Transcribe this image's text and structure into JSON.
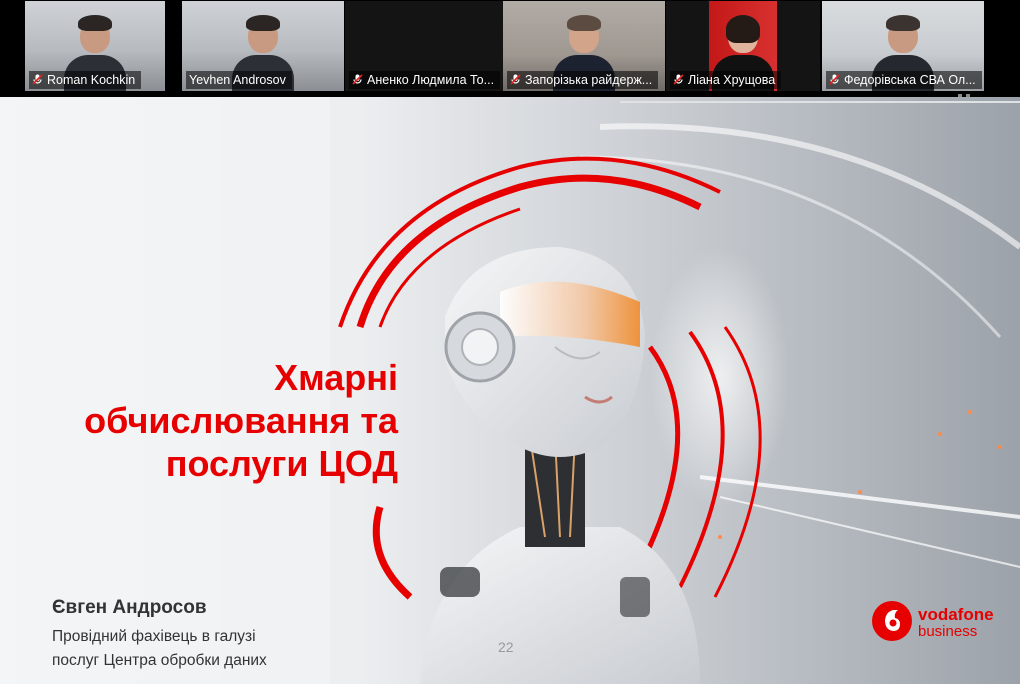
{
  "participants": [
    {
      "name": "Roman Kochkin",
      "muted": true,
      "active": false
    },
    {
      "name": "Yevhen Androsov",
      "muted": false,
      "active": true
    },
    {
      "name": "Аненко Людмила То...",
      "muted": true,
      "active": false
    },
    {
      "name": "Запорізька райдерж...",
      "muted": true,
      "active": false
    },
    {
      "name": "Ліана Хрущова",
      "muted": true,
      "active": false
    },
    {
      "name": "Федорівська СВА Ол...",
      "muted": true,
      "active": false
    }
  ],
  "slide": {
    "title_lines": [
      "Хмарні",
      "обчислювання та",
      "послуги ЦОД"
    ],
    "presenter_name": "Євген Андросов",
    "presenter_role_lines": [
      "Провідний фахівець в галузі",
      "послуг Центра обробки даних"
    ],
    "page_number": "22",
    "brand_name": "vodafone",
    "brand_sub": "business"
  },
  "colors": {
    "accent": "#e60000",
    "active_speaker": "#23d160"
  },
  "icons": {
    "muted": "mic-off-icon",
    "view_options": "grid-dots-icon"
  }
}
